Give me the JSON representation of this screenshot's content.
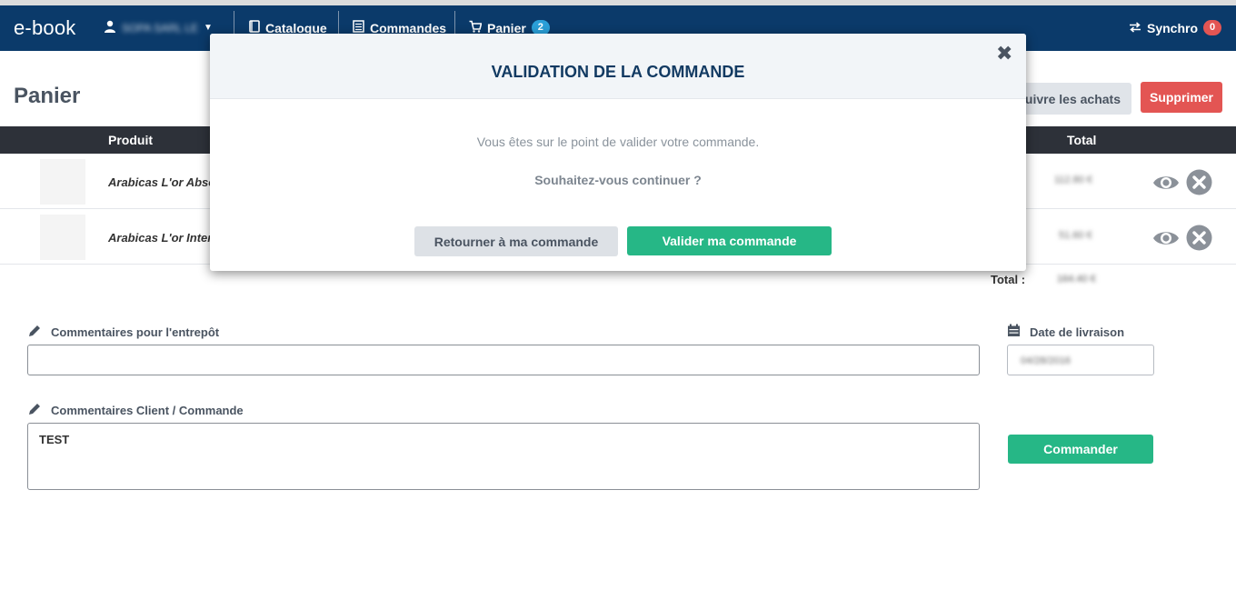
{
  "navbar": {
    "brand": "e-book",
    "user_name": "SOPA SARL LE",
    "catalogue": "Catalogue",
    "commandes": "Commandes",
    "panier": "Panier",
    "panier_count": "2",
    "synchro": "Synchro",
    "synchro_count": "0"
  },
  "page": {
    "title": "Panier",
    "continue_button": "suivre les achats",
    "delete_button": "Supprimer"
  },
  "table": {
    "headers": {
      "product": "Produit",
      "total": "Total"
    },
    "rows": [
      {
        "product": "Arabicas L'or Absolu",
        "price": "112.80 €"
      },
      {
        "product": "Arabicas L'or Intense",
        "price": "51.60 €"
      }
    ],
    "total_label": "Total :",
    "total_value": "164.40 €"
  },
  "form": {
    "warehouse_label": "Commentaires pour l'entrepôt",
    "warehouse_value": "",
    "client_label": "Commentaires Client / Commande",
    "client_value": "TEST",
    "delivery_label": "Date de livraison",
    "delivery_value": "04/28/2016",
    "order_button": "Commander"
  },
  "modal": {
    "title": "VALIDATION DE LA COMMANDE",
    "close": "✖",
    "message": "Vous êtes sur le point de valider votre commande.",
    "question": "Souhaitez-vous continuer ?",
    "back_button": "Retourner à ma commande",
    "validate_button": "Valider ma commande"
  },
  "colors": {
    "navbar": "#0b3a6a",
    "danger": "#e35553",
    "success": "#26b786",
    "info": "#2a9fd8"
  },
  "icons": [
    "user-icon",
    "book-icon",
    "list-icon",
    "cart-icon",
    "sync-icon",
    "eye-icon",
    "remove-icon",
    "pencil-icon",
    "calendar-icon",
    "close-icon"
  ]
}
